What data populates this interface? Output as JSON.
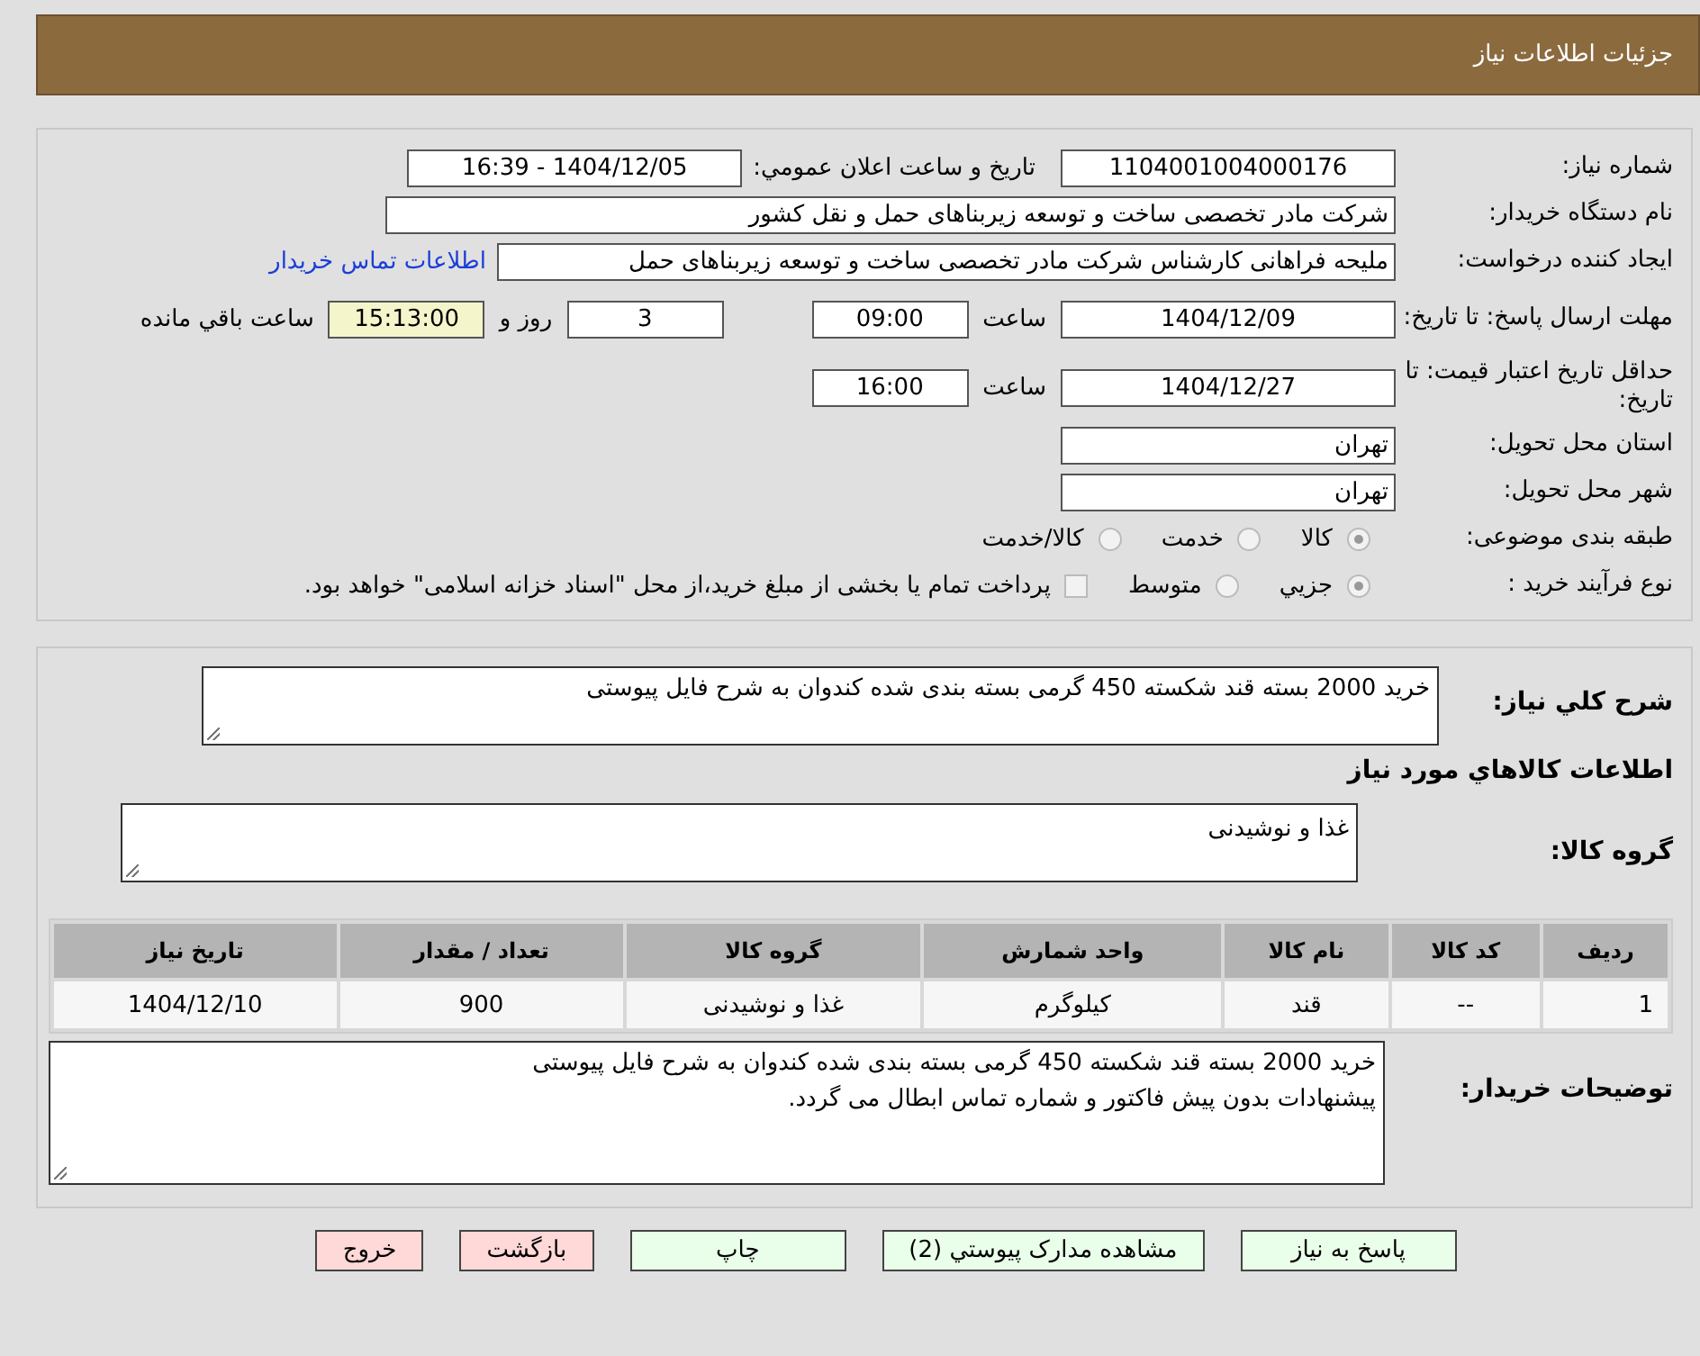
{
  "header": {
    "title": "جزئیات اطلاعات نیاز"
  },
  "info": {
    "need_number": {
      "label": "شماره نیاز:",
      "value": "1104001004000176"
    },
    "announce": {
      "label": "تاريخ و ساعت اعلان عمومي:",
      "value": "1404/12/05 - 16:39"
    },
    "buyer": {
      "label": "نام دستگاه خريدار:",
      "value": "شرکت مادر تخصصی ساخت و توسعه زیربناهای حمل و نقل کشور"
    },
    "creator": {
      "label": "ايجاد کننده درخواست:",
      "value": "ملیحه فراهانی کارشناس شرکت مادر تخصصی ساخت و توسعه زیربناهای حمل",
      "link": "اطلاعات تماس خريدار"
    },
    "deadline": {
      "label": "مهلت ارسال پاسخ: تا تاریخ:",
      "date": "1404/12/09",
      "time_label": "ساعت",
      "time": "09:00",
      "days": "3",
      "days_label": "روز و",
      "remaining": "15:13:00",
      "remaining_label": "ساعت باقي مانده"
    },
    "validity": {
      "label": "حداقل تاريخ اعتبار قيمت: تا تاريخ:",
      "date": "1404/12/27",
      "time_label": "ساعت",
      "time": "16:00"
    },
    "province": {
      "label": "استان محل تحویل:",
      "value": "تهران"
    },
    "city": {
      "label": "شهر محل تحویل:",
      "value": "تهران"
    },
    "category": {
      "label": "طبقه بندی موضوعی:",
      "options": [
        {
          "kind": "radio",
          "label": "كالا",
          "selected": true
        },
        {
          "kind": "radio",
          "label": "خدمت",
          "selected": false
        },
        {
          "kind": "radio",
          "label": "كالا/خدمت",
          "selected": false
        }
      ]
    },
    "process": {
      "label": "نوع فرآيند خريد :",
      "options": [
        {
          "kind": "radio",
          "label": "جزيي",
          "selected": true
        },
        {
          "kind": "radio",
          "label": "متوسط",
          "selected": false
        },
        {
          "kind": "checkbox",
          "label": "پرداخت تمام يا بخشی از مبلغ خريد،از محل \"اسناد خزانه اسلامی\" خواهد بود.",
          "selected": false
        }
      ]
    }
  },
  "details": {
    "description": {
      "label": "شرح کلي نياز:",
      "value": "خرید 2000 بسته قند شکسته 450 گرمی بسته بندی شده کندوان به شرح فایل پیوستی"
    },
    "goods_title": "اطلاعات کالاهاي مورد نياز",
    "group": {
      "label": "گروه کالا:",
      "value": "غذا و نوشیدنی"
    },
    "table": {
      "columns": [
        "رديف",
        "کد کالا",
        "نام کالا",
        "واحد شمارش",
        "گروه کالا",
        "تعداد / مقدار",
        "تاريخ نياز"
      ],
      "rows": [
        [
          "1",
          "--",
          "قند",
          "کیلوگرم",
          "غذا و نوشیدنی",
          "900",
          "1404/12/10"
        ]
      ]
    },
    "notes": {
      "label": "توضيحات خريدار:",
      "lines": [
        "خرید 2000 بسته قند شکسته 450 گرمی بسته بندی شده کندوان به شرح فایل پیوستی",
        "پیشنهادات بدون پیش فاکتور و شماره تماس ابطال می گردد."
      ]
    }
  },
  "buttons": [
    {
      "label": "پاسخ به نياز",
      "kind": "action"
    },
    {
      "label": "مشاهده مدارک پيوستي (2)",
      "kind": "action"
    },
    {
      "label": "چاپ",
      "kind": "action"
    },
    {
      "label": "بازگشت",
      "kind": "danger"
    },
    {
      "label": "خروج",
      "kind": "danger"
    }
  ]
}
